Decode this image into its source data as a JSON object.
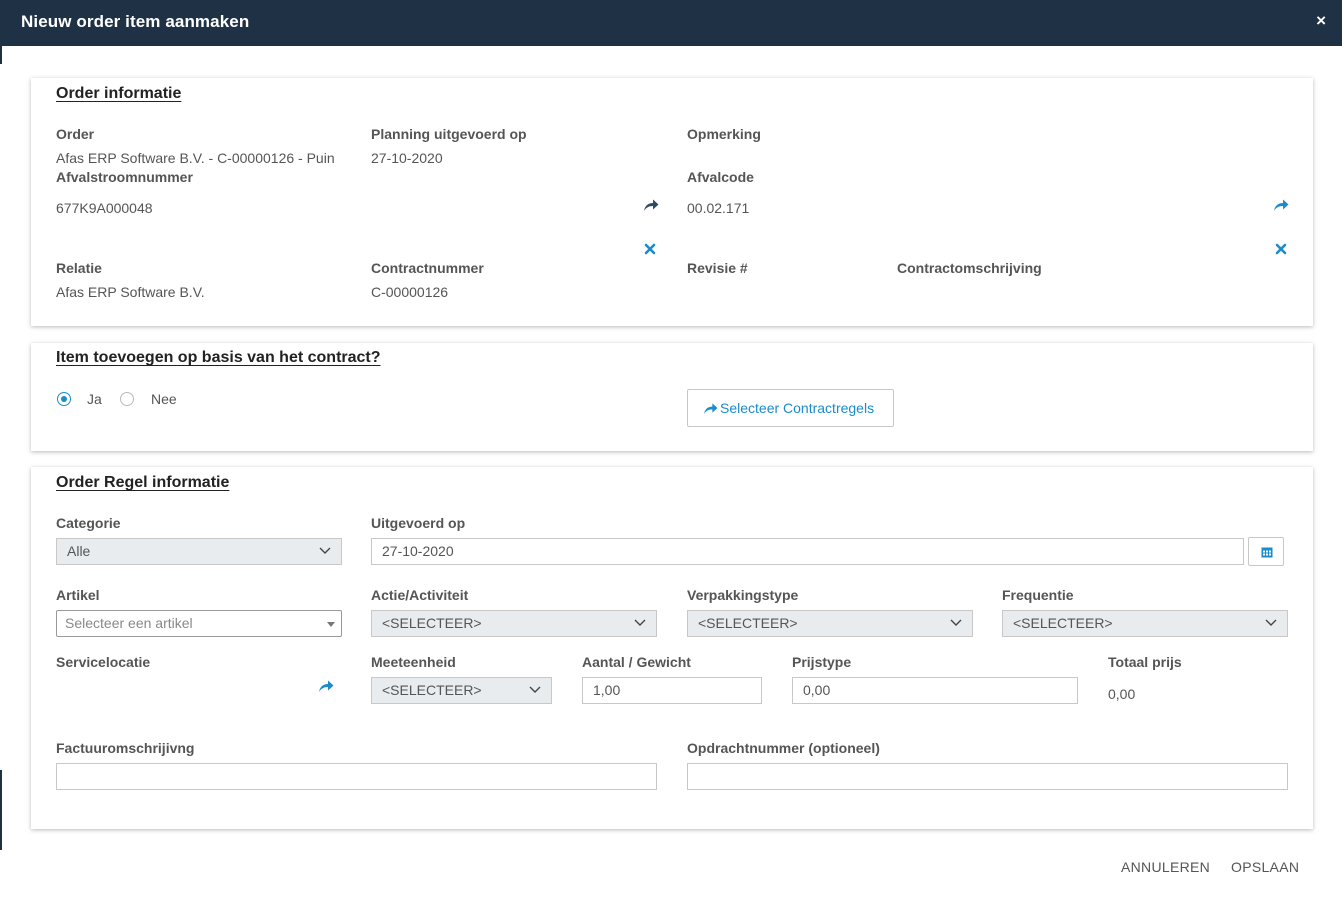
{
  "dialog": {
    "title": "Nieuw order item aanmaken",
    "close_glyph": "×"
  },
  "order_info": {
    "title": "Order informatie",
    "order_label": "Order",
    "order_value": "Afas ERP Software B.V. - C-00000126 - Puin",
    "planning_label": "Planning uitgevoerd op",
    "planning_value": "27-10-2020",
    "opmerking_label": "Opmerking",
    "afvalstroom_label": "Afvalstroomnummer",
    "afvalstroom_value": "677K9A000048",
    "afvalcode_label": "Afvalcode",
    "afvalcode_value": "00.02.171",
    "relatie_label": "Relatie",
    "relatie_value": "Afas ERP Software B.V.",
    "contractnummer_label": "Contractnummer",
    "contractnummer_value": "C-00000126",
    "revisie_label": "Revisie #",
    "contractomschrijving_label": "Contractomschrijving"
  },
  "contract_section": {
    "title": "Item toevoegen op basis van het contract?",
    "radio_yes": "Ja",
    "radio_no": "Nee",
    "selected": "Ja",
    "select_button": "Selecteer Contractregels"
  },
  "order_regel": {
    "title": "Order Regel informatie",
    "categorie_label": "Categorie",
    "categorie_value": "Alle",
    "uitgevoerd_label": "Uitgevoerd op",
    "uitgevoerd_value": "27-10-2020",
    "artikel_label": "Artikel",
    "artikel_placeholder": "Selecteer een artikel",
    "actie_label": "Actie/Activiteit",
    "actie_value": "<SELECTEER>",
    "verpakking_label": "Verpakkingstype",
    "verpakking_value": "<SELECTEER>",
    "frequentie_label": "Frequentie",
    "frequentie_value": "<SELECTEER>",
    "servicelocatie_label": "Servicelocatie",
    "meeteenheid_label": "Meeteenheid",
    "meeteenheid_value": "<SELECTEER>",
    "aantal_label": "Aantal / Gewicht",
    "aantal_value": "1,00",
    "prijstype_label": "Prijstype",
    "prijstype_value": "0,00",
    "totaal_label": "Totaal prijs",
    "totaal_value": "0,00",
    "factuur_label": "Factuuromschrijivng",
    "factuur_value": "",
    "opdracht_label": "Opdrachtnummer (optioneel)",
    "opdracht_value": ""
  },
  "footer": {
    "cancel": "ANNULEREN",
    "save": "OPSLAAN"
  },
  "colors": {
    "header_bg": "#1f3245",
    "accent": "#1a8ccc",
    "icon_dark": "#2d4a66"
  },
  "icons": {
    "share": "share-arrow-icon",
    "clear": "close-x-icon",
    "calendar": "calendar-icon",
    "chevron": "chevron-down-icon"
  }
}
